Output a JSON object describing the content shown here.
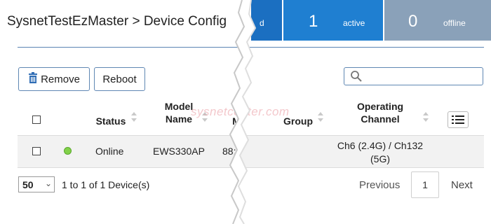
{
  "header": {
    "breadcrumb": "SysnetTestEzMaster > Device Config"
  },
  "status_tiles": [
    {
      "label": "d",
      "color": "#1b6fc1"
    },
    {
      "count": "1",
      "label": "active",
      "color": "#1f7fd1"
    },
    {
      "count": "0",
      "label": "offline",
      "color": "#8aa1b9"
    }
  ],
  "toolbar": {
    "remove_label": "Remove",
    "reboot_label": "Reboot",
    "search_placeholder": ""
  },
  "table": {
    "columns": {
      "status": "Status",
      "model_name": "Model Name",
      "mac_partial": "M",
      "group": "Group",
      "operating_channel": "Operating Channel"
    },
    "rows": [
      {
        "status": "Online",
        "status_color": "#82d14a",
        "model_name": "EWS330AP",
        "mac_partial": "88:",
        "operating_channel": "Ch6 (2.4G) / Ch132 (5G)"
      }
    ]
  },
  "watermark": "sysnetcenter.com",
  "footer": {
    "page_size": "50",
    "summary": "1 to 1 of 1 Device(s)",
    "previous_label": "Previous",
    "current_page": "1",
    "next_label": "Next"
  }
}
